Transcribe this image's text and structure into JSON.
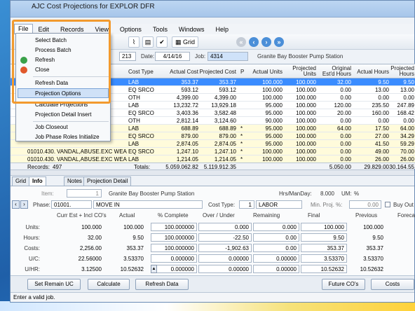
{
  "window": {
    "title": "AJC Cost Projections for EXPLOR DFR"
  },
  "menubar": {
    "items": [
      "File",
      "Edit",
      "Records",
      "View",
      "Options",
      "Tools",
      "Windows",
      "Help"
    ]
  },
  "toolbar": {
    "grid_label": "Grid"
  },
  "filter": {
    "id_value": "213",
    "date_label": "Date:",
    "date_value": "4/14/16",
    "job_label": "Job:",
    "job_value": "4314",
    "job_name": "Granite Bay Booster Pump Station"
  },
  "file_menu": {
    "items": [
      {
        "label": "Select Batch"
      },
      {
        "label": "Process Batch"
      },
      {
        "label": "Refresh"
      },
      {
        "label": "Close"
      },
      {
        "label": "Refresh Data"
      },
      {
        "label": "Projection Options"
      },
      {
        "label": "Calculate Projections"
      },
      {
        "label": "Projection Detail Insert"
      },
      {
        "label": "Job Closeout"
      },
      {
        "label": "Job Phase Roles Initialize"
      }
    ]
  },
  "grid": {
    "headers": [
      "Cost Type",
      "Actual Cost",
      "Projected Cost",
      "P",
      "Actual Units",
      "Projected Units",
      "Original Est'd Hours",
      "Actual Hours",
      "Projected Hours"
    ],
    "rows": [
      {
        "phase": "",
        "desc": "",
        "type": "LAB",
        "actual": "353.37",
        "proj": "353.37",
        "p": "",
        "units": "100.000",
        "punits": "100.000",
        "orig": "32.00",
        "ahrs": "9.50",
        "phrs": "9.50"
      },
      {
        "phase": "",
        "desc": "",
        "type": "EQ SRCO",
        "actual": "593.12",
        "proj": "593.12",
        "p": "",
        "units": "100.000",
        "punits": "100.000",
        "orig": "0.00",
        "ahrs": "13.00",
        "phrs": "13.00"
      },
      {
        "phase": "",
        "desc": "",
        "type": "OTH",
        "actual": "4,399.00",
        "proj": "4,399.00",
        "p": "",
        "units": "100.000",
        "punits": "100.000",
        "orig": "0.00",
        "ahrs": "0.00",
        "phrs": "0.00"
      },
      {
        "phase": "",
        "desc": "",
        "type": "LAB",
        "actual": "13,232.72",
        "proj": "13,929.18",
        "p": "",
        "units": "95.000",
        "punits": "100.000",
        "orig": "120.00",
        "ahrs": "235.50",
        "phrs": "247.89"
      },
      {
        "phase": "",
        "desc": "",
        "type": "EQ SRCO",
        "actual": "3,403.36",
        "proj": "3,582.48",
        "p": "",
        "units": "95.000",
        "punits": "100.000",
        "orig": "20.00",
        "ahrs": "160.00",
        "phrs": "168.42"
      },
      {
        "phase": "",
        "desc": "",
        "type": "OTH",
        "actual": "2,812.14",
        "proj": "3,124.60",
        "p": "",
        "units": "90.000",
        "punits": "100.000",
        "orig": "0.00",
        "ahrs": "0.00",
        "phrs": "0.00"
      },
      {
        "phase": "",
        "desc": "",
        "type": "LAB",
        "actual": "688.89",
        "proj": "688.89",
        "p": "*",
        "units": "95.000",
        "punits": "100.000",
        "orig": "64.00",
        "ahrs": "17.50",
        "phrs": "64.00"
      },
      {
        "phase": "",
        "desc": "",
        "type": "EQ SRCO",
        "actual": "879.00",
        "proj": "879.00",
        "p": "*",
        "units": "95.000",
        "punits": "100.000",
        "orig": "0.00",
        "ahrs": "27.00",
        "phrs": "34.29"
      },
      {
        "phase": "",
        "desc": "",
        "type": "LAB",
        "actual": "2,874.05",
        "proj": "2,874.05",
        "p": "*",
        "units": "95.000",
        "punits": "100.000",
        "orig": "0.00",
        "ahrs": "41.50",
        "phrs": "59.29"
      },
      {
        "phase": "01010.430.",
        "desc": "VANDAL,ABUSE.EXC WEAR",
        "type": "EQ SRCO",
        "actual": "1,247.10",
        "proj": "1,247.10",
        "p": "*",
        "units": "100.000",
        "punits": "100.000",
        "orig": "0.00",
        "ahrs": "49.00",
        "phrs": "70.00"
      },
      {
        "phase": "01010.430.",
        "desc": "VANDAL,ABUSE.EXC WEAR",
        "type": "LAB",
        "actual": "1,214.05",
        "proj": "1,214.05",
        "p": "*",
        "units": "100.000",
        "punits": "100.000",
        "orig": "0.00",
        "ahrs": "26.00",
        "phrs": "26.00"
      }
    ],
    "footer": {
      "records_label": "Records:",
      "records_value": "497",
      "totals_label": "Totals:",
      "total_actual": "5,059,062.82",
      "total_proj": "5,119,912.35",
      "total_orig": "5,050.00",
      "total_ahrs": "29,829.00",
      "total_phrs": "30,164.55"
    }
  },
  "detail_tabs": [
    "Grid",
    "Info",
    "Notes",
    "Projection Detail"
  ],
  "detail": {
    "item_label": "Item:",
    "item_value": "1",
    "item_name": "Granite Bay Booster Pump Station",
    "hrs_label": "Hrs/ManDay:",
    "hrs_value": "8.000",
    "um_label": "UM:",
    "um_value": "%",
    "phase_label": "Phase:",
    "phase_value": "01001.",
    "phase_name": "MOVE IN",
    "cost_type_label": "Cost Type:",
    "cost_type_num": "1",
    "cost_type_name": "LABOR",
    "min_proj_label": "Min. Proj. %:",
    "min_proj_value": "0.00",
    "buy_out_label": "Buy Out",
    "col_headers": [
      "Curr Est + Incl CO's",
      "Actual",
      "% Complete",
      "Over / Under",
      "Remaining",
      "Final",
      "Previous",
      "Forecast"
    ],
    "rows": [
      {
        "label": "Units:",
        "curr": "100.000",
        "actual": "100.000",
        "pct": "100.000000",
        "over": "0.000",
        "remaining": "0.000",
        "final": "100.000",
        "previous": "100.000",
        "forecast": ""
      },
      {
        "label": "Hours:",
        "curr": "32.00",
        "actual": "9.50",
        "pct": "100.000000",
        "over": "-22.50",
        "remaining": "0.00",
        "final": "9.50",
        "previous": "9.50",
        "forecast": ""
      },
      {
        "label": "Costs:",
        "curr": "2,256.00",
        "actual": "353.37",
        "pct": "100.000000",
        "over": "-1,902.63",
        "remaining": "0.00",
        "final": "353.37",
        "previous": "353.37",
        "forecast": ""
      },
      {
        "label": "U/C:",
        "curr": "22.56000",
        "actual": "3.53370",
        "pct": "0.000000",
        "over": "0.00000",
        "remaining": "0.00000",
        "final": "3.53370",
        "previous": "3.53370",
        "forecast": ""
      },
      {
        "label": "U/HR:",
        "curr": "3.12500",
        "actual": "10.52632",
        "pct": "0.000000",
        "over": "0.00000",
        "remaining": "0.00000",
        "final": "10.52632",
        "previous": "10.52632",
        "forecast": ""
      }
    ]
  },
  "buttons": {
    "set_remain": "Set Remain UC",
    "calculate": "Calculate",
    "refresh_data": "Refresh Data",
    "future_cos": "Future CO's",
    "costs": "Costs"
  },
  "status": "Enter a valid job.",
  "colors": {
    "selection": "#3a8cff",
    "highlight_border": "#f29a2e",
    "yellow_row": "#fffbdb"
  }
}
